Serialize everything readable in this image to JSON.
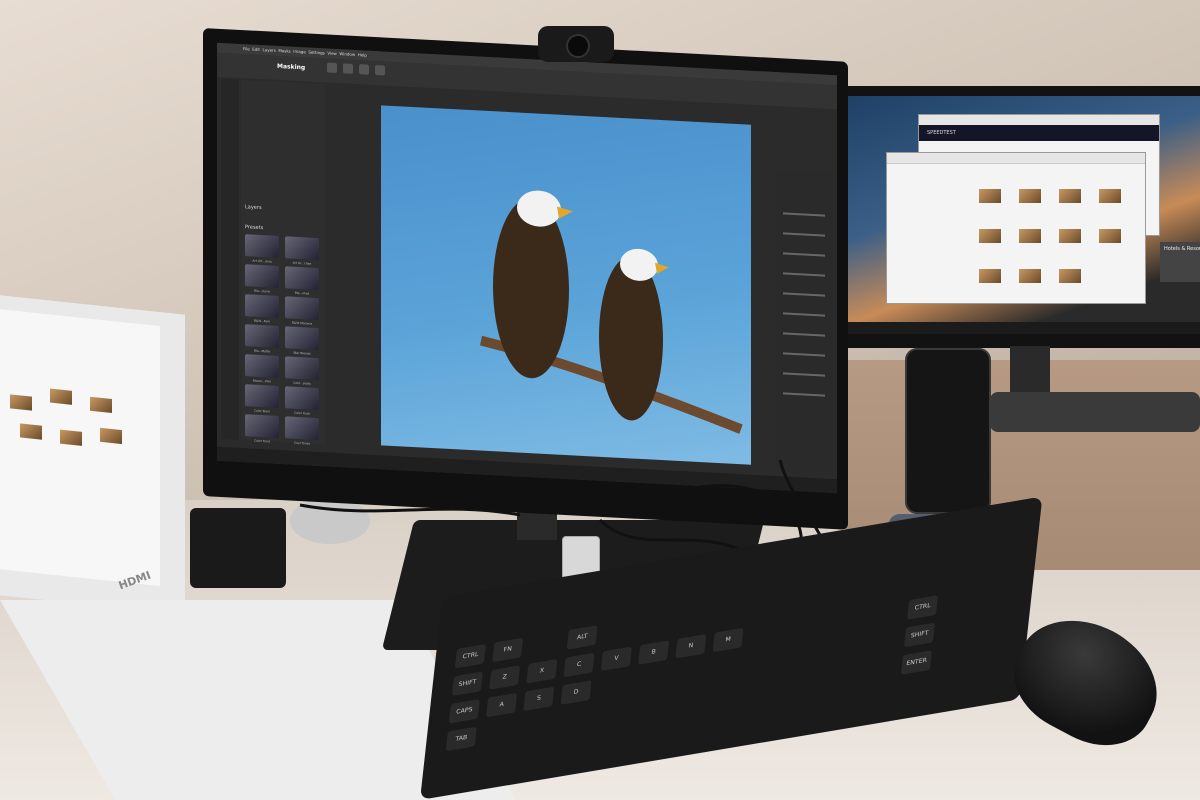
{
  "photo": {
    "main_monitor": {
      "app_menu": [
        "File",
        "Edit",
        "Layers",
        "Masks",
        "Image",
        "Settings",
        "View",
        "Window",
        "Help"
      ],
      "app_mode": "Masking",
      "panel": {
        "layers_heading": "Layers",
        "presets_heading": "Presets",
        "presets": [
          "Art Art...ania",
          "Art Gr...chan",
          "Bla...ctone",
          "Bla...nted",
          "B&W...Fern",
          "B&W Moclera",
          "Bla...Matte",
          "Bler Blends",
          "Bloom...Film",
          "Cold...seats",
          "Color Elem",
          "Color Fuse",
          "Color Tond",
          "Cool Tones"
        ]
      },
      "canvas_subject": "two bald eagles on a branch",
      "colors": {
        "sky": "#4a90cc",
        "ui_dark": "#2b2b2b"
      }
    },
    "right_monitor": {
      "browser_header": "SPEEDTEST",
      "side_caption": "Hotels & Resorts"
    },
    "laptop": {
      "port_label": "HDMI"
    },
    "keyboard": {
      "keys_visible": [
        "TAB",
        "CAPS",
        "SHIFT",
        "CTRL",
        "FN",
        "ALT",
        "ENTER",
        "SHIFT",
        "CTRL",
        "A",
        "S",
        "D",
        "Z",
        "X",
        "C",
        "V",
        "B",
        "N",
        "M"
      ]
    }
  }
}
